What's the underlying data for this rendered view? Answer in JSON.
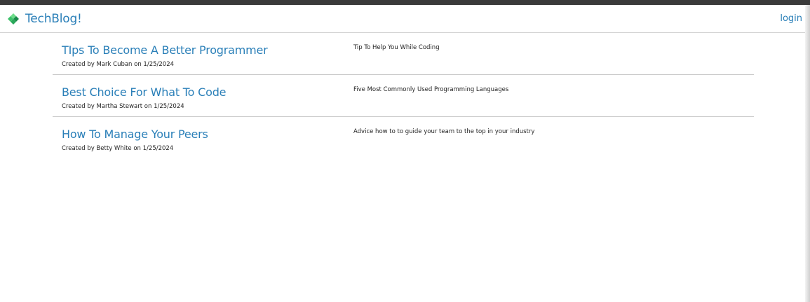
{
  "header": {
    "brand": "TechBlog!",
    "brand_icon": "diamond-logo-icon",
    "login_label": "login",
    "accent_color": "#2a7fb8"
  },
  "posts": [
    {
      "title": "TIps To Become A Better Programmer",
      "meta": "Created by Mark Cuban on 1/25/2024",
      "description": "Tip To Help You While Coding"
    },
    {
      "title": "Best Choice For What To Code",
      "meta": "Created by Martha Stewart on 1/25/2024",
      "description": "Five Most Commonly Used Programming Languages"
    },
    {
      "title": "How To Manage Your Peers",
      "meta": "Created by Betty White on 1/25/2024",
      "description": "Advice how to to guide your team to the top in your industry"
    }
  ]
}
